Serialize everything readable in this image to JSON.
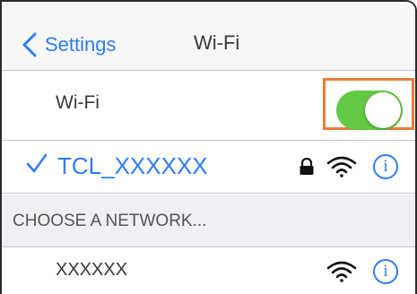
{
  "navbar": {
    "back_label": "Settings",
    "title": "Wi-Fi"
  },
  "wifi_toggle": {
    "label": "Wi-Fi",
    "state": "on",
    "color": "#63c843",
    "highlight_color": "#ee7a33"
  },
  "connected_network": {
    "name": "TCL_XXXXXX",
    "selected": true,
    "secured": true,
    "icons": [
      "checkmark-icon",
      "lock-icon",
      "wifi-signal-icon",
      "info-icon"
    ],
    "info_glyph": "i"
  },
  "section": {
    "header": "CHOOSE A NETWORK..."
  },
  "networks": [
    {
      "name": "XXXXXX",
      "icons": [
        "wifi-signal-icon",
        "info-icon"
      ],
      "info_glyph": "i"
    }
  ],
  "colors": {
    "accent": "#2f7cf6",
    "separator": "#c8c7cc",
    "section_bg": "#efeff4"
  }
}
